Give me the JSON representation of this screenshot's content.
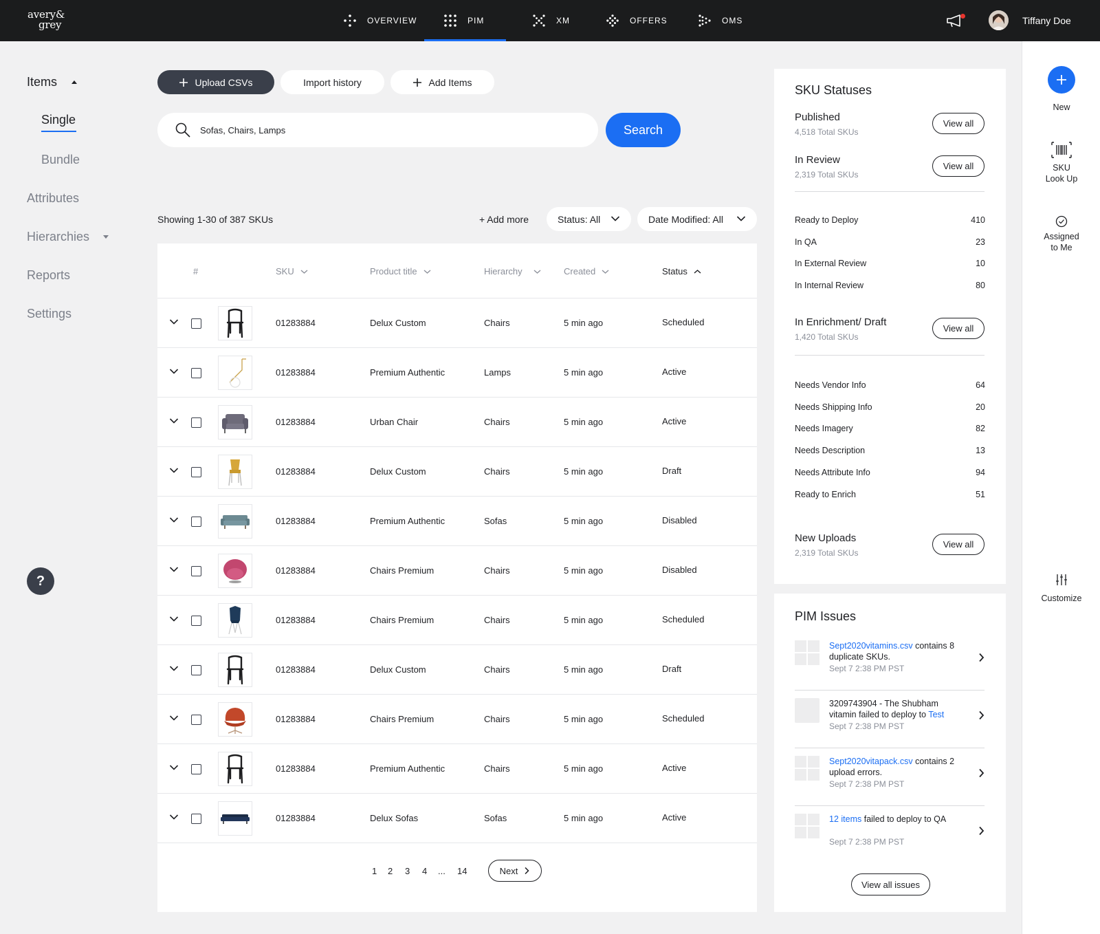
{
  "brand": {
    "line1": "avery&",
    "line2": "grey"
  },
  "nav": {
    "items": [
      {
        "label": "OVERVIEW",
        "icon": "overview-icon"
      },
      {
        "label": "PIM",
        "icon": "grid-dots-icon",
        "active": true
      },
      {
        "label": "XM",
        "icon": "xm-icon"
      },
      {
        "label": "OFFERS",
        "icon": "offers-icon"
      },
      {
        "label": "OMS",
        "icon": "oms-icon"
      }
    ],
    "user_name": "Tiffany Doe",
    "accent_color": "#1b6ef3"
  },
  "sidebar": {
    "items_label": "Items",
    "single_label": "Single",
    "bundle_label": "Bundle",
    "attributes_label": "Attributes",
    "hierarchies_label": "Hierarchies",
    "reports_label": "Reports",
    "settings_label": "Settings",
    "help_label": "?"
  },
  "actions": {
    "upload_label": "Upload CSVs",
    "import_label": "Import history",
    "add_label": "Add Items"
  },
  "search": {
    "value": "Sofas, Chairs, Lamps",
    "button_label": "Search"
  },
  "listing": {
    "showing": "Showing 1-30 of 387 SKUs",
    "add_more": "+ Add more",
    "status_filter": "Status: All",
    "date_filter": "Date Modified: All"
  },
  "table": {
    "columns": {
      "num": "#",
      "sku": "SKU",
      "title": "Product title",
      "hierarchy": "Hierarchy",
      "created": "Created",
      "status": "Status"
    },
    "rows": [
      {
        "sku": "01283884",
        "title": "Delux Custom",
        "hierarchy": "Chairs",
        "created": "5 min ago",
        "status": "Scheduled",
        "thumb": "black-chair"
      },
      {
        "sku": "01283884",
        "title": "Premium Authentic",
        "hierarchy": "Lamps",
        "created": "5 min ago",
        "status": "Active",
        "thumb": "lamp"
      },
      {
        "sku": "01283884",
        "title": "Urban Chair",
        "hierarchy": "Chairs",
        "created": "5 min ago",
        "status": "Active",
        "thumb": "armchair"
      },
      {
        "sku": "01283884",
        "title": "Delux Custom",
        "hierarchy": "Chairs",
        "created": "5 min ago",
        "status": "Draft",
        "thumb": "yellow-chair"
      },
      {
        "sku": "01283884",
        "title": "Premium Authentic",
        "hierarchy": "Sofas",
        "created": "5 min ago",
        "status": "Disabled",
        "thumb": "teal-sofa"
      },
      {
        "sku": "01283884",
        "title": "Chairs Premium",
        "hierarchy": "Chairs",
        "created": "5 min ago",
        "status": "Disabled",
        "thumb": "pink-chair"
      },
      {
        "sku": "01283884",
        "title": "Chairs Premium",
        "hierarchy": "Chairs",
        "created": "5 min ago",
        "status": "Scheduled",
        "thumb": "blue-chair"
      },
      {
        "sku": "01283884",
        "title": "Delux Custom",
        "hierarchy": "Chairs",
        "created": "5 min ago",
        "status": "Draft",
        "thumb": "black-chair"
      },
      {
        "sku": "01283884",
        "title": "Chairs Premium",
        "hierarchy": "Chairs",
        "created": "5 min ago",
        "status": "Scheduled",
        "thumb": "orange-chair"
      },
      {
        "sku": "01283884",
        "title": "Premium Authentic",
        "hierarchy": "Chairs",
        "created": "5 min ago",
        "status": "Active",
        "thumb": "black-chair"
      },
      {
        "sku": "01283884",
        "title": "Delux Sofas",
        "hierarchy": "Sofas",
        "created": "5 min ago",
        "status": "Active",
        "thumb": "navy-sofa"
      }
    ]
  },
  "pagination": {
    "pages": [
      "1",
      "2",
      "3",
      "4",
      "...",
      "14"
    ],
    "next_label": "Next"
  },
  "sku_statuses": {
    "title": "SKU Statuses",
    "view_all": "View all",
    "published": {
      "name": "Published",
      "sub": "4,518 Total SKUs"
    },
    "in_review": {
      "name": "In Review",
      "sub": "2,319 Total SKUs"
    },
    "review_breakdown": [
      {
        "name": "Ready to Deploy",
        "value": "410"
      },
      {
        "name": "In QA",
        "value": "23"
      },
      {
        "name": "In External Review",
        "value": "10"
      },
      {
        "name": "In Internal Review",
        "value": "80"
      }
    ],
    "enrichment": {
      "name": "In Enrichment/ Draft",
      "sub": "1,420 Total SKUs"
    },
    "enrichment_breakdown": [
      {
        "name": "Needs Vendor Info",
        "value": "64"
      },
      {
        "name": "Needs Shipping Info",
        "value": "20"
      },
      {
        "name": "Needs Imagery",
        "value": "82"
      },
      {
        "name": "Needs Description",
        "value": "13"
      },
      {
        "name": "Needs Attribute Info",
        "value": "94"
      },
      {
        "name": "Ready to Enrich",
        "value": "51"
      }
    ],
    "new_uploads": {
      "name": "New Uploads",
      "sub": "2,319 Total SKUs"
    }
  },
  "pim_issues": {
    "title": "PIM Issues",
    "items": [
      {
        "link": "Sept2020vitamins.csv",
        "text": " contains 8 duplicate SKUs.",
        "time": "Sept 7 2:38 PM PST"
      },
      {
        "pre": "3209743904 - The Shubham vitamin failed to deploy to ",
        "link": "Test",
        "time": "Sept 7 2:38 PM PST"
      },
      {
        "link": "Sept2020vitapack.csv",
        "text": " contains 2 upload errors.",
        "time": "Sept 7 2:38 PM PST"
      },
      {
        "link": "12 items",
        "text": " failed to deploy to QA",
        "time": "Sept 7 2:38 PM PST"
      }
    ],
    "view_all_label": "View all issues"
  },
  "rail": {
    "new_label": "New",
    "sku_lookup_label1": "SKU",
    "sku_lookup_label2": "Look Up",
    "assigned_label1": "Assigned",
    "assigned_label2": "to Me",
    "customize_label": "Customize"
  }
}
